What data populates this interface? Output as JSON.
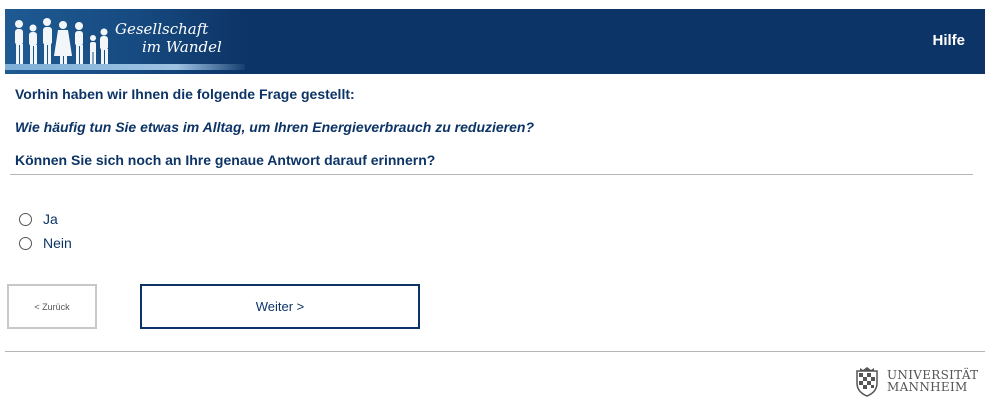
{
  "header": {
    "logo_line1": "Gesellschaft",
    "logo_line2": "im Wandel",
    "help_label": "Hilfe"
  },
  "question": {
    "intro": "Vorhin haben wir Ihnen die folgende Frage gestellt:",
    "previous_question": "Wie häufig tun Sie etwas im Alltag, um Ihren Energieverbrauch zu reduzieren?",
    "prompt": "Können Sie sich noch an Ihre genaue Antwort darauf erinnern?"
  },
  "options": [
    {
      "label": "Ja",
      "selected": false
    },
    {
      "label": "Nein",
      "selected": false
    }
  ],
  "buttons": {
    "back_label": "< Zurück",
    "next_label": "Weiter >"
  },
  "footer": {
    "uni_line1": "UNIVERSITÄT",
    "uni_line2": "MANNHEIM"
  },
  "colors": {
    "brand_navy": "#0d3466",
    "logo_light_blue": "#7fb0d8"
  }
}
